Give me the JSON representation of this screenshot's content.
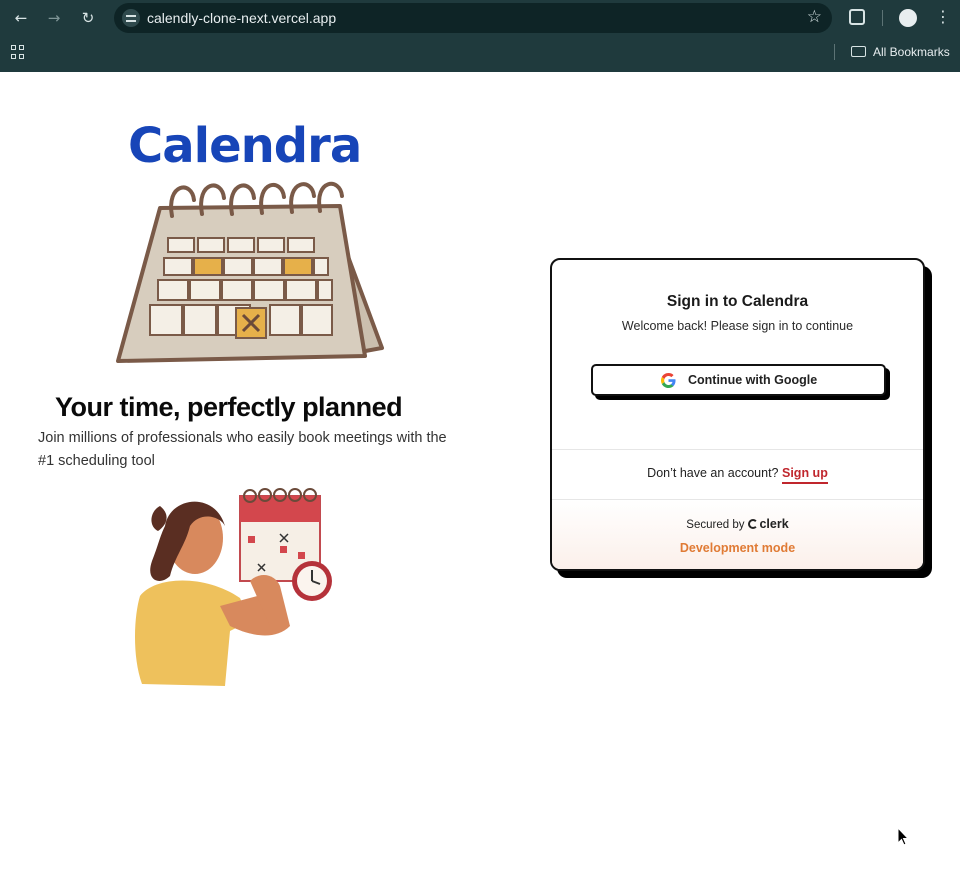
{
  "browser": {
    "url": "calendly-clone-next.vercel.app",
    "bookmarks_label": "All Bookmarks",
    "icons": [
      "back-icon",
      "forward-icon",
      "reload-icon",
      "site-info-icon",
      "star-icon",
      "extensions-icon",
      "profile-icon",
      "menu-icon",
      "apps-icon",
      "folder-icon"
    ]
  },
  "hero": {
    "logo": "Calendra",
    "tagline": "Your time, perfectly planned",
    "subtitle": "Join millions of professionals who easily book meetings with the #1 scheduling tool"
  },
  "signin": {
    "title": "Sign in to Calendra",
    "subtitle": "Welcome back! Please sign in to continue",
    "google_button": "Continue with Google",
    "no_account_text": "Don’t have an account?",
    "signup_link": "Sign up",
    "secured_by": "Secured by",
    "clerk_brand": "clerk",
    "dev_mode": "Development mode"
  },
  "colors": {
    "chrome_bg": "#1f3a3d",
    "logo_blue": "#1745b8",
    "signup_red": "#c0262d",
    "devmode_orange": "#e07b35"
  }
}
